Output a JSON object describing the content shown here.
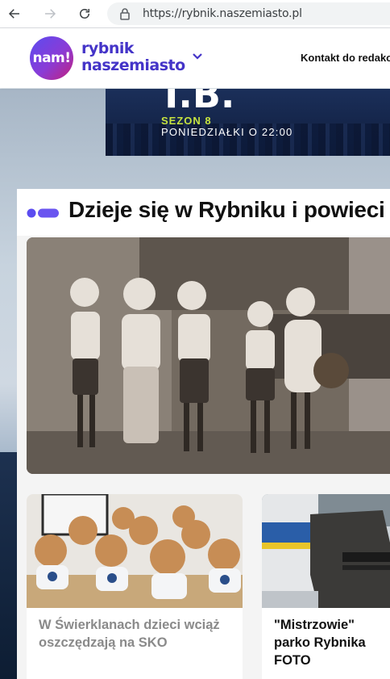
{
  "browser": {
    "url": "https://rybnik.naszemiasto.pl"
  },
  "header": {
    "logo_badge": "nam!",
    "logo_line1": "rybnik",
    "logo_line2": "naszemiasto",
    "contact_link": "Kontakt do redako"
  },
  "banner": {
    "big_text": "T.B.",
    "season": "SEZON 8",
    "schedule": "PONIEDZIAŁKI O 22:00"
  },
  "section": {
    "title": "Dzieje się w Rybniku i powieci"
  },
  "articles": [
    {
      "title": "W Świerklanach dzieci wciąż oszczędzają na SKO",
      "color": "#8a8a8a"
    },
    {
      "title": "\"Mistrzowie\" parko Rybnika FOTO",
      "color": "#111111"
    }
  ],
  "colors": {
    "brand": "#4434c8",
    "accent_green": "#c6e33f"
  }
}
